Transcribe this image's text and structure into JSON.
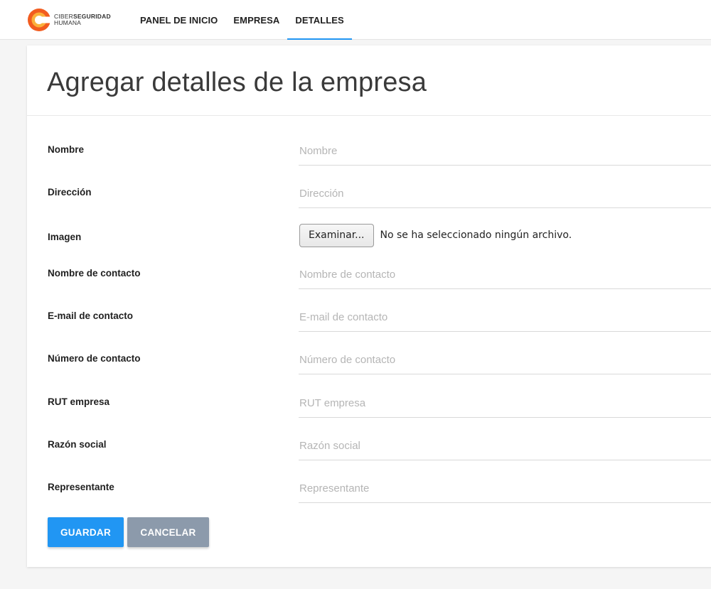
{
  "brand": {
    "line1_a": "CIBER",
    "line1_b": "SEGURIDAD",
    "line2": "HUMANA",
    "colors": {
      "outer": "#f25c1f",
      "inner": "#fbb03b"
    }
  },
  "nav": {
    "items": [
      {
        "label": "PANEL DE INICIO",
        "active": false
      },
      {
        "label": "EMPRESA",
        "active": false
      },
      {
        "label": "DETALLES",
        "active": true
      }
    ],
    "accent": "#2196f3"
  },
  "page": {
    "title": "Agregar detalles de la empresa"
  },
  "form": {
    "fields": {
      "nombre": {
        "label": "Nombre",
        "placeholder": "Nombre"
      },
      "direccion": {
        "label": "Dirección",
        "placeholder": "Dirección"
      },
      "imagen": {
        "label": "Imagen",
        "button": "Examinar...",
        "status": "No se ha seleccionado ningún archivo."
      },
      "contacto_nombre": {
        "label": "Nombre de contacto",
        "placeholder": "Nombre de contacto"
      },
      "contacto_email": {
        "label": "E-mail de contacto",
        "placeholder": "E-mail de contacto"
      },
      "contacto_numero": {
        "label": "Número de contacto",
        "placeholder": "Número de contacto"
      },
      "rut": {
        "label": "RUT empresa",
        "placeholder": "RUT empresa"
      },
      "razon": {
        "label": "Razón social",
        "placeholder": "Razón social"
      },
      "representante": {
        "label": "Representante",
        "placeholder": "Representante"
      }
    },
    "buttons": {
      "save": "GUARDAR",
      "cancel": "CANCELAR"
    }
  }
}
